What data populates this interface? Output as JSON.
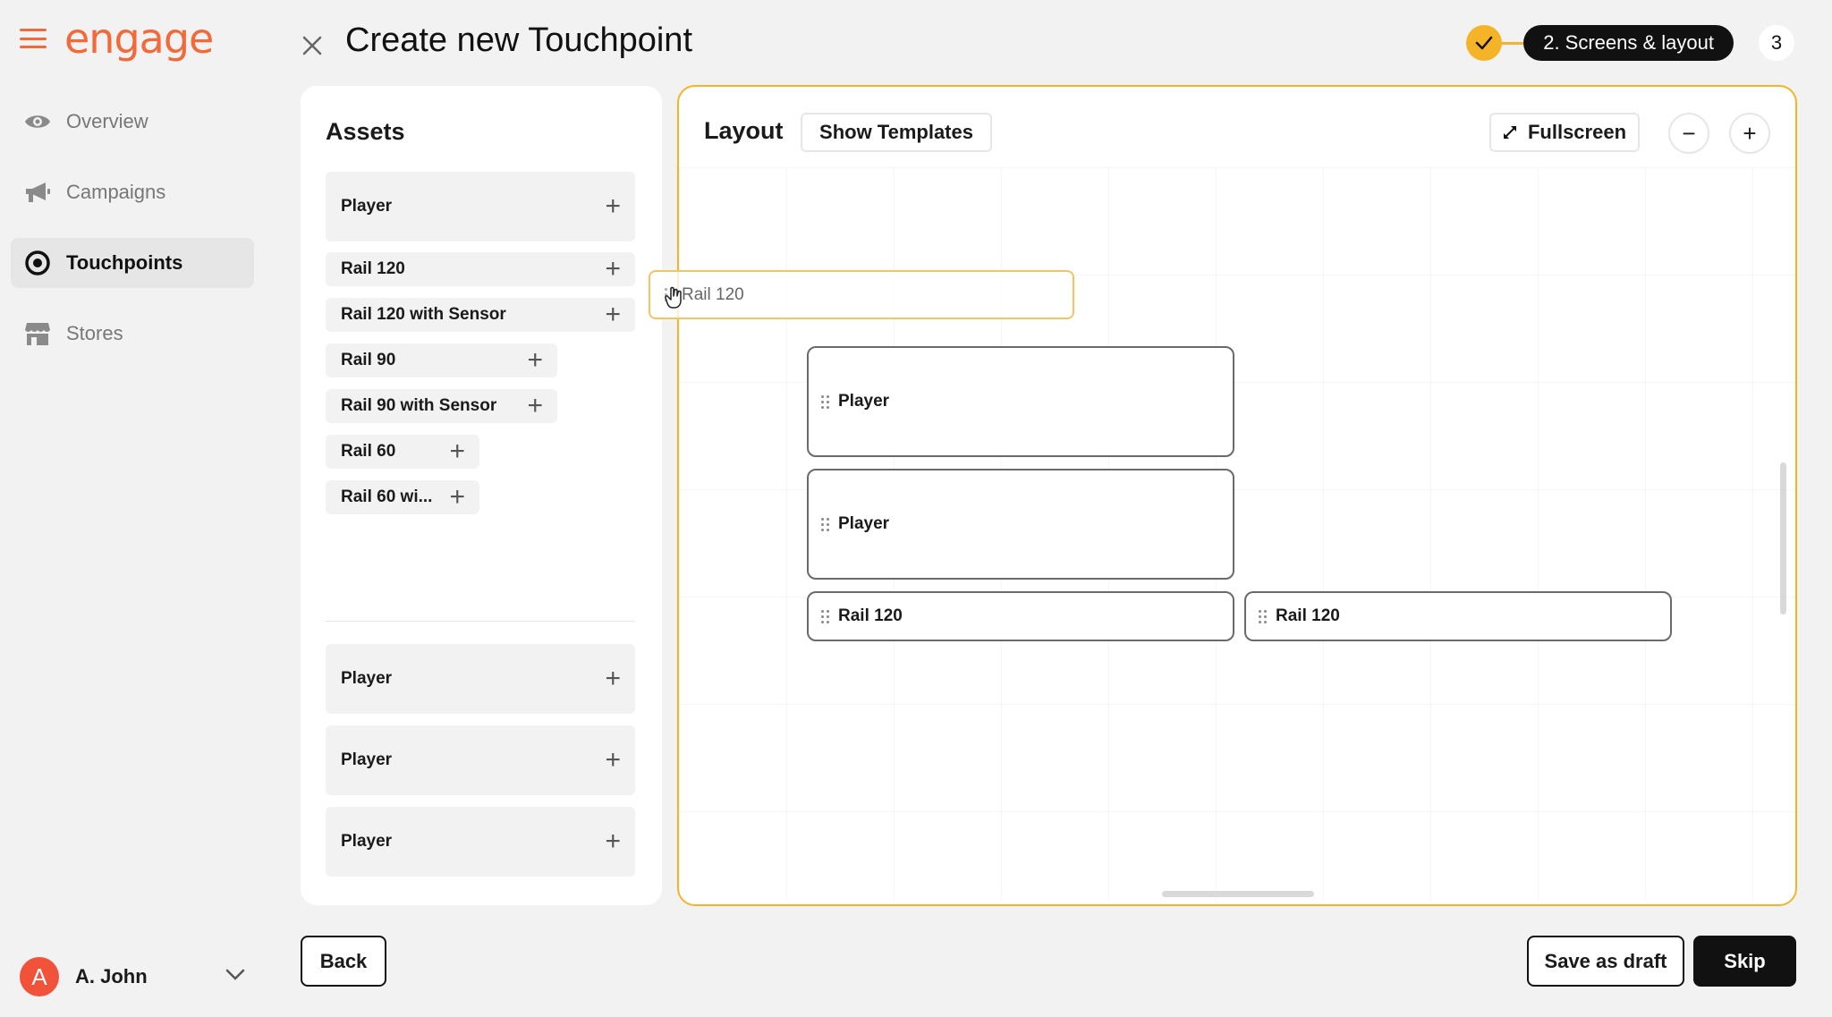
{
  "brand": {
    "name": "engage"
  },
  "nav": [
    {
      "label": "Overview",
      "icon": "eye-icon",
      "active": false
    },
    {
      "label": "Campaigns",
      "icon": "megaphone-icon",
      "active": false
    },
    {
      "label": "Touchpoints",
      "icon": "target-icon",
      "active": true
    },
    {
      "label": "Stores",
      "icon": "store-icon",
      "active": false
    }
  ],
  "user": {
    "initial": "A",
    "name": "A. John"
  },
  "header": {
    "title": "Create new Touchpoint"
  },
  "stepper": {
    "active_label": "2. Screens & layout",
    "next_label": "3"
  },
  "assets": {
    "title": "Assets",
    "items": [
      {
        "label": "Player"
      },
      {
        "label": "Rail 120"
      },
      {
        "label": "Rail 120 with Sensor"
      },
      {
        "label": "Rail 90"
      },
      {
        "label": "Rail 90 with Sensor"
      },
      {
        "label": "Rail 60"
      },
      {
        "label": "Rail 60 wi..."
      },
      {
        "label": "Player"
      },
      {
        "label": "Player"
      },
      {
        "label": "Player"
      }
    ]
  },
  "layout": {
    "title": "Layout",
    "show_templates": "Show Templates",
    "fullscreen": "Fullscreen",
    "zoom_out": "−",
    "zoom_in": "+",
    "blocks": [
      {
        "label": "Player"
      },
      {
        "label": "Player"
      },
      {
        "label": "Rail 120"
      },
      {
        "label": "Rail 120"
      }
    ],
    "dragging": "Rail 120"
  },
  "footer": {
    "back": "Back",
    "save_draft": "Save as draft",
    "skip": "Skip"
  },
  "colors": {
    "brand": "#f26a3a",
    "accent": "#f5b428",
    "dark": "#111111"
  }
}
